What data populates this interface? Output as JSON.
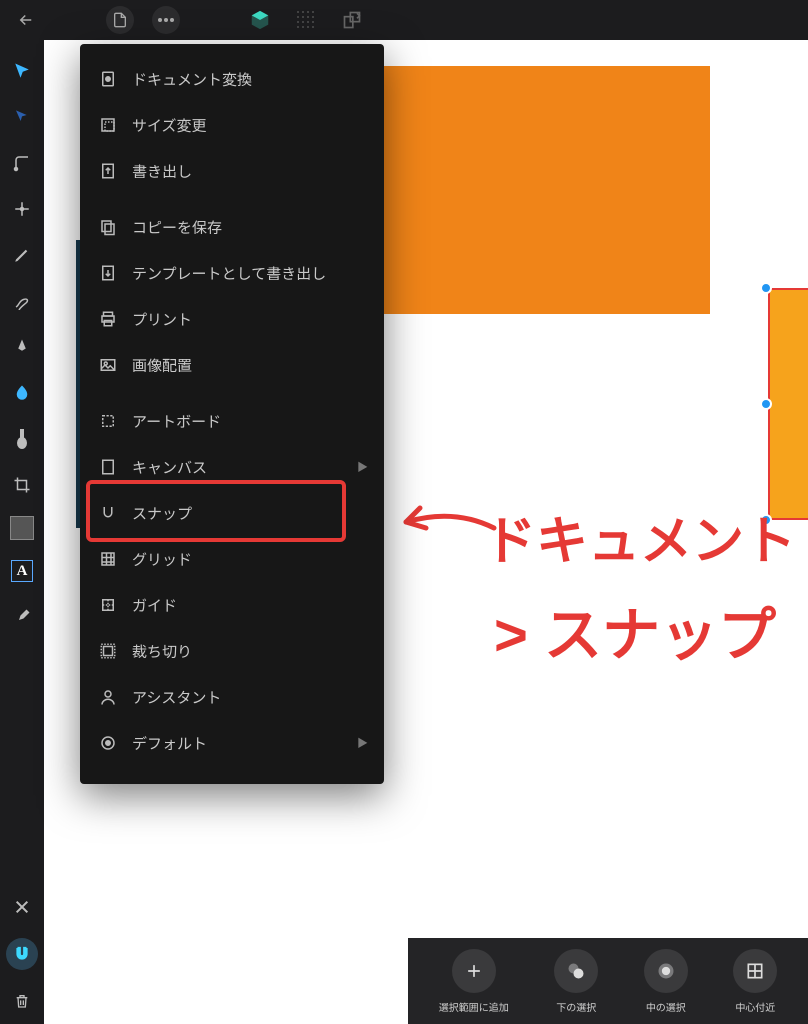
{
  "topbar": {
    "back": "back-icon",
    "doc": "document-icon",
    "more": "more-icon",
    "app": "affinity-icon",
    "grid": "grid-icon",
    "transform": "transform-icon"
  },
  "tools": [
    {
      "name": "move-tool",
      "active": true
    },
    {
      "name": "node-tool"
    },
    {
      "name": "corner-tool"
    },
    {
      "name": "point-transform-tool"
    },
    {
      "name": "pencil-tool"
    },
    {
      "name": "vector-brush-tool"
    },
    {
      "name": "pen-tool"
    },
    {
      "name": "color-picker-tool",
      "active": true
    },
    {
      "name": "gradient-tool"
    },
    {
      "name": "crop-tool"
    },
    {
      "name": "fill-selector"
    },
    {
      "name": "artistic-text-tool"
    },
    {
      "name": "eyedropper-tool"
    }
  ],
  "bottom_tools": [
    {
      "name": "close-icon"
    },
    {
      "name": "snap-magnet-icon",
      "active": true
    },
    {
      "name": "delete-icon"
    }
  ],
  "menu": {
    "items": [
      {
        "icon": "convert-icon",
        "label": "ドキュメント変換"
      },
      {
        "icon": "resize-icon",
        "label": "サイズ変更"
      },
      {
        "icon": "export-icon",
        "label": "書き出し"
      },
      {
        "gap": true
      },
      {
        "icon": "save-copy-icon",
        "label": "コピーを保存"
      },
      {
        "icon": "export-template-icon",
        "label": "テンプレートとして書き出し"
      },
      {
        "icon": "print-icon",
        "label": "プリント"
      },
      {
        "icon": "place-image-icon",
        "label": "画像配置"
      },
      {
        "gap": true
      },
      {
        "icon": "artboard-icon",
        "label": "アートボード"
      },
      {
        "icon": "canvas-icon",
        "label": "キャンバス",
        "sub": true
      },
      {
        "icon": "snap-icon",
        "label": "スナップ"
      },
      {
        "icon": "grid-icon",
        "label": "グリッド"
      },
      {
        "icon": "guide-icon",
        "label": "ガイド"
      },
      {
        "icon": "bleed-icon",
        "label": "裁ち切り"
      },
      {
        "icon": "assistant-icon",
        "label": "アシスタント"
      },
      {
        "icon": "default-icon",
        "label": "デフォルト",
        "sub": true
      }
    ]
  },
  "annotation": {
    "line1": "ドキュメント",
    "line2": "> スナップ"
  },
  "context_bar": [
    {
      "icon": "plus-icon",
      "label": "選択範囲に追加"
    },
    {
      "icon": "below-icon",
      "label": "下の選択"
    },
    {
      "icon": "inside-icon",
      "label": "中の選択"
    },
    {
      "icon": "center-icon",
      "label": "中心付近"
    }
  ]
}
